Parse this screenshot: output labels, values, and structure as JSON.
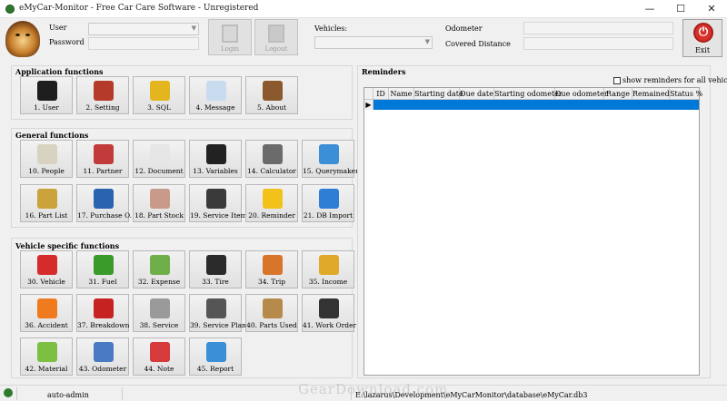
{
  "window": {
    "title": "eMyCar-Monitor - Free Car Care Software - Unregistered",
    "controls": [
      "—",
      "☐",
      "✕"
    ]
  },
  "header": {
    "user_label": "User",
    "password_label": "Password",
    "login_label": "Login",
    "logout_label": "Logout",
    "vehicles_label": "Vehicles:",
    "odometer_label": "Odometer",
    "covered_distance_label": "Covered Distance",
    "exit_label": "Exit"
  },
  "groups": {
    "application": {
      "title": "Application functions",
      "tiles": [
        {
          "label": "1. User",
          "icon": "user-icon",
          "color": "#1e1e1e"
        },
        {
          "label": "2. Setting",
          "icon": "tools-icon",
          "color": "#b53a2a"
        },
        {
          "label": "3. SQL",
          "icon": "lock-icon",
          "color": "#e3b51f"
        },
        {
          "label": "4. Message",
          "icon": "envelope-icon",
          "color": "#c9dcef"
        },
        {
          "label": "5. About",
          "icon": "book-icon",
          "color": "#8a5a2e"
        }
      ]
    },
    "general": {
      "title": "General functions",
      "tiles": [
        {
          "label": "10. People",
          "icon": "contact-card-icon",
          "color": "#d8d2c0"
        },
        {
          "label": "11. Partner",
          "icon": "storefront-icon",
          "color": "#c23b3b"
        },
        {
          "label": "12. Document",
          "icon": "document-icon",
          "color": "#e6e6e6"
        },
        {
          "label": "13. Variables",
          "icon": "terminal-icon",
          "color": "#222222"
        },
        {
          "label": "14. Calculator",
          "icon": "calculator-icon",
          "color": "#6b6b6b"
        },
        {
          "label": "15. Querymaker",
          "icon": "shapes-icon",
          "color": "#3a8fd6"
        },
        {
          "label": "16. Part List",
          "icon": "box-icon",
          "color": "#caa43a"
        },
        {
          "label": "17. Purchase O.",
          "icon": "basket-icon",
          "color": "#2a63b0"
        },
        {
          "label": "18. Part Stock",
          "icon": "price-tag-icon",
          "color": "#c99a8a"
        },
        {
          "label": "19. Service Item",
          "icon": "pushpin-icon",
          "color": "#3a3a3a"
        },
        {
          "label": "20. Reminder",
          "icon": "warning-icon",
          "color": "#f2c21b"
        },
        {
          "label": "21. DB Import",
          "icon": "undo-arrow-icon",
          "color": "#2f7ed6"
        }
      ]
    },
    "vehicle": {
      "title": "Vehicle specific functions",
      "tiles": [
        {
          "label": "30. Vehicle",
          "icon": "car-icon",
          "color": "#d62b2b"
        },
        {
          "label": "31. Fuel",
          "icon": "fuel-pump-icon",
          "color": "#3a9a2a"
        },
        {
          "label": "32. Expense",
          "icon": "money-icon",
          "color": "#6fae4a"
        },
        {
          "label": "33. Tire",
          "icon": "tire-icon",
          "color": "#2a2a2a"
        },
        {
          "label": "34. Trip",
          "icon": "house-icon",
          "color": "#d9742b"
        },
        {
          "label": "35. Income",
          "icon": "coins-icon",
          "color": "#e0a92a"
        },
        {
          "label": "36. Accident",
          "icon": "traffic-cone-icon",
          "color": "#f07b1e"
        },
        {
          "label": "37. Breakdown",
          "icon": "no-entry-icon",
          "color": "#c72222"
        },
        {
          "label": "38. Service",
          "icon": "gears-icon",
          "color": "#9a9a9a"
        },
        {
          "label": "39. Service Plan",
          "icon": "calendar-24-icon",
          "color": "#555555"
        },
        {
          "label": "40. Parts Used",
          "icon": "clipboard-icon",
          "color": "#b58a4a"
        },
        {
          "label": "41. Work Order",
          "icon": "list-icon",
          "color": "#333333"
        },
        {
          "label": "42. Material",
          "icon": "flask-icon",
          "color": "#7bc043"
        },
        {
          "label": "43. Odometer",
          "icon": "ruler-pencil-icon",
          "color": "#4a7ac4"
        },
        {
          "label": "44. Note",
          "icon": "calendar-note-icon",
          "color": "#d63b3b"
        },
        {
          "label": "45. Report",
          "icon": "pie-chart-icon",
          "color": "#3a8fd6"
        }
      ]
    }
  },
  "reminders": {
    "title": "Reminders",
    "show_all_label": "show reminders for all vehicles",
    "columns": [
      "ID",
      "Name",
      "Starting date",
      "Due date",
      "Starting odometer",
      "Due odometer",
      "Range",
      "Remained",
      "Status %"
    ]
  },
  "statusbar": {
    "user": "auto-admin",
    "db_path": "E:\\lazarus\\Development\\eMyCarMonitor\\database\\eMyCar.db3"
  },
  "watermark": "GearDownload.com"
}
